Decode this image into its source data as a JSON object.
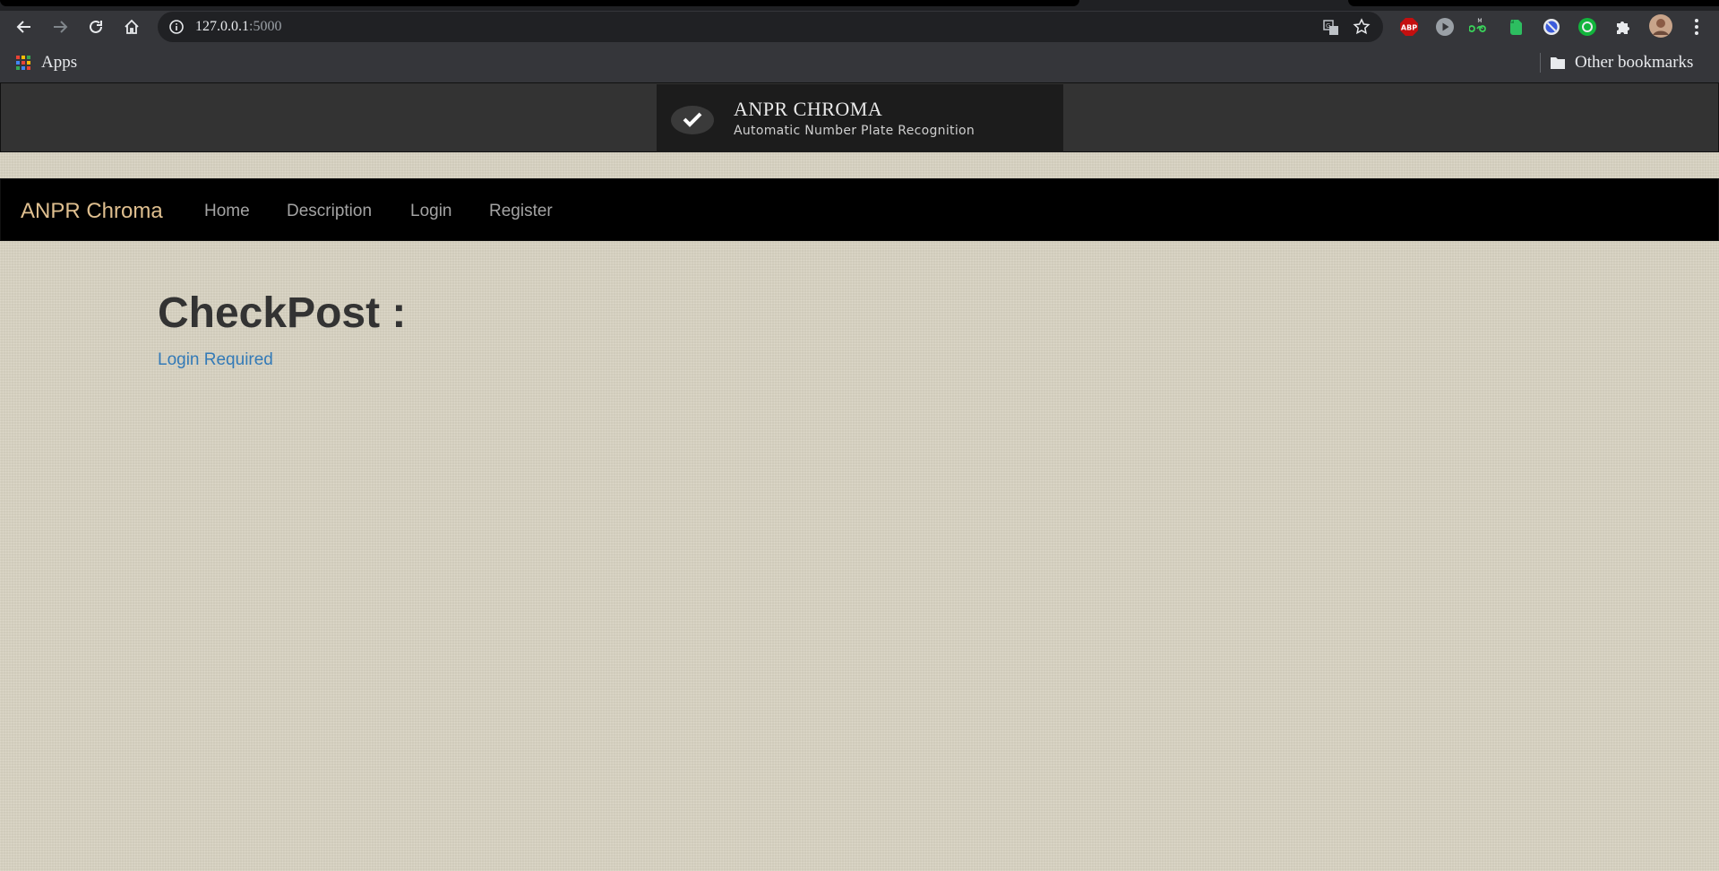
{
  "browser": {
    "url_host": "127.0.0.1",
    "url_port": ":5000",
    "bookmarks": {
      "apps_label": "Apps",
      "other_label": "Other bookmarks"
    },
    "extensions": [
      "adblock-plus-icon",
      "play-icon",
      "infinity-icon",
      "evernote-icon",
      "blocker-icon",
      "green-circle-icon",
      "puzzle-icon",
      "profile-avatar"
    ],
    "abp_text": "ABP"
  },
  "banner": {
    "title": "ANPR CHROMA",
    "subtitle": "Automatic Number Plate Recognition"
  },
  "navbar": {
    "brand": "ANPR Chroma",
    "links": [
      "Home",
      "Description",
      "Login",
      "Register"
    ]
  },
  "main": {
    "heading": "CheckPost :",
    "login_link": "Login Required"
  },
  "colors": {
    "navbar_bg": "#000000",
    "brand": "#dfbf8f",
    "nav_link": "#a3a3a3",
    "link": "#337ab7",
    "page_bg": "#d9d4c3",
    "banner_bg": "#1c1c1c"
  }
}
